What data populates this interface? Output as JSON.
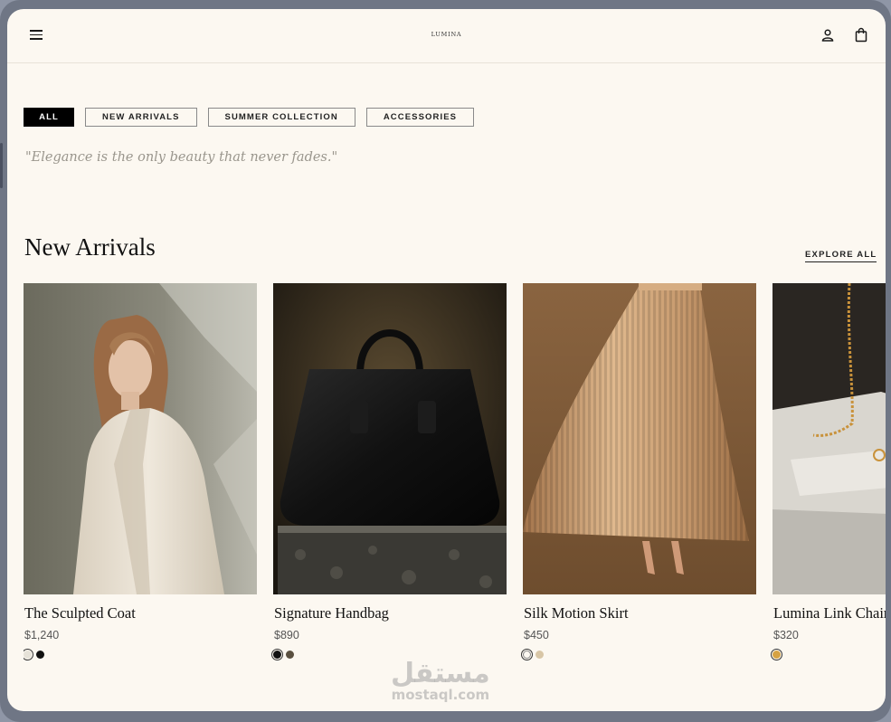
{
  "header": {
    "logo": "LUMINA",
    "icons": [
      "menu-icon",
      "user-icon",
      "shopping-bag-icon"
    ]
  },
  "filters": [
    {
      "label": "ALL",
      "active": true
    },
    {
      "label": "NEW ARRIVALS",
      "active": false
    },
    {
      "label": "SUMMER COLLECTION",
      "active": false
    },
    {
      "label": "ACCESSORIES",
      "active": false
    }
  ],
  "quote": "\"Elegance is the only beauty that never fades.\"",
  "section": {
    "title": "New Arrivals",
    "explore_label": "EXPLORE ALL"
  },
  "products": [
    {
      "name": "The Sculpted Coat",
      "price": "$1,240",
      "swatches": [
        "#e6e2d8",
        "#111111"
      ],
      "selected": 0
    },
    {
      "name": "Signature Handbag",
      "price": "$890",
      "swatches": [
        "#111111",
        "#5a5040"
      ],
      "selected": 0
    },
    {
      "name": "Silk Motion Skirt",
      "price": "$450",
      "swatches": [
        "#fcf8f1",
        "#d8c6a6"
      ],
      "selected": 0
    },
    {
      "name": "Lumina Link Chain",
      "price": "$320",
      "swatches": [
        "#d6a243"
      ],
      "selected": 0
    }
  ],
  "watermark": {
    "arabic": "مستقل",
    "latin": "mostaql.com"
  },
  "colors": {
    "background": "#fcf8f1",
    "accent": "#000000",
    "muted": "#9a968d"
  }
}
